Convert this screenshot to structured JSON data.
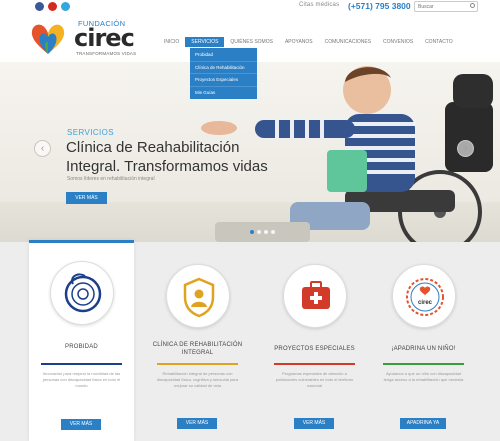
{
  "topbar": {
    "contact_label": "Citas médicas",
    "phone": "(+571) 795 3800",
    "search_placeholder": "Buscar"
  },
  "logo": {
    "foundation": "FUNDACIÓN",
    "name": "cirec",
    "tagline": "TRANSFORMAMOS VIDAS"
  },
  "nav": {
    "items": [
      {
        "label": "Inicio",
        "active": false
      },
      {
        "label": "Servicios",
        "active": true
      },
      {
        "label": "Quiénes somos",
        "active": false
      },
      {
        "label": "Apoyanos",
        "active": false
      },
      {
        "label": "Comunicaciones",
        "active": false
      },
      {
        "label": "Convenios",
        "active": false
      },
      {
        "label": "Contacto",
        "active": false
      }
    ],
    "dropdown": [
      "Probidad",
      "Clínica de Rehabilitación",
      "Proyectos Especiales",
      "Mis Guías"
    ]
  },
  "hero": {
    "kicker": "SERVICIOS",
    "title": "Clínica de Reahabilitación Integral. Transformamos vidas",
    "description": "Somos líderes en rehabilitación integral",
    "button": "VER MÁS"
  },
  "cards": [
    {
      "title": "PROBIDAD",
      "text": "Innovación para mejorar la movilidad de las personas con discapacidad física en todo el mundo",
      "button": "VER MÁS",
      "accent": "#1c3f8a",
      "icon": "bike-wheel-icon"
    },
    {
      "title": "CLÍNICA DE REHABILITACIÓN INTEGRAL",
      "text": "Rehabilitación integral de personas con discapacidad física, cognitiva y sensorial para mejorar su calidad de vida",
      "button": "VER MÁS",
      "accent": "#e0a321",
      "icon": "person-shield-icon"
    },
    {
      "title": "PROYECTOS ESPECIALES",
      "text": "Programas especiales de atención a poblaciones vulnerables en todo el territorio nacional",
      "button": "VER MÁS",
      "accent": "#d23b2a",
      "icon": "first-aid-kit-icon"
    },
    {
      "title": "¡APADRINA UN NIÑO!",
      "text": "Ayúdanos a que un niño con discapacidad tenga acceso a la rehabilitación que necesita",
      "button": "APADRINA YA",
      "accent": "#3a9c3c",
      "icon": "cirec-seal-icon"
    }
  ],
  "colors": {
    "brand_blue": "#2b7fc5",
    "hero_bg": "#efece6"
  }
}
